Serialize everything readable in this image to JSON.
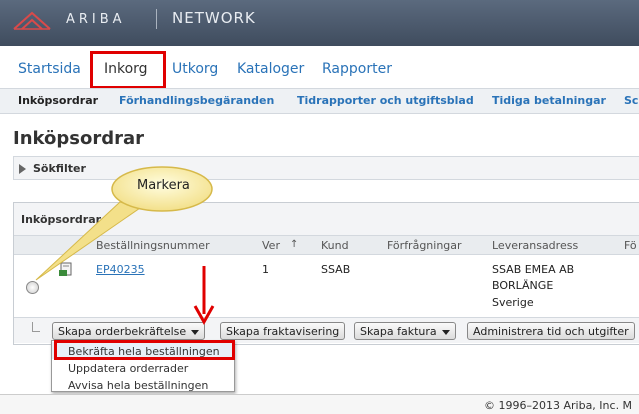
{
  "header": {
    "brand": "ARIBA",
    "product": "NETWORK",
    "logo_icon": "ariba-logo-icon"
  },
  "tabs": [
    {
      "label": "Startsida"
    },
    {
      "label": "Inkorg",
      "active": true
    },
    {
      "label": "Utkorg"
    },
    {
      "label": "Kataloger"
    },
    {
      "label": "Rapporter"
    }
  ],
  "subnav": [
    {
      "label": "Inköpsordrar",
      "active": true
    },
    {
      "label": "Förhandlingsbegäranden"
    },
    {
      "label": "Tidrapporter och utgiftsblad"
    },
    {
      "label": "Tidiga betalningar"
    },
    {
      "label": "Sc"
    }
  ],
  "page_title": "Inköpsordrar",
  "filter": {
    "label": "Sökfilter"
  },
  "panel": {
    "title": "Inköpsordrar",
    "columns": [
      "Beställningsnummer",
      "Ver",
      "Kund",
      "Förfrågningar",
      "Leveransadress",
      "Fö"
    ],
    "sort_icon": "sort-ascending-icon",
    "rows": [
      {
        "order_number": "EP40235",
        "ver": "1",
        "customer": "SSAB",
        "requests": "",
        "address_line1": "SSAB EMEA AB",
        "address_line2": "BORLÄNGE",
        "address_line3": "Sverige"
      }
    ]
  },
  "actions": {
    "create_confirmation": "Skapa orderbekräftelse",
    "create_shipping": "Skapa fraktavisering",
    "create_invoice": "Skapa faktura",
    "manage_time": "Administrera tid och utgifter"
  },
  "dropdown": {
    "items": [
      {
        "label": "Bekräfta hela beställningen",
        "highlighted": true
      },
      {
        "label": "Uppdatera orderrader"
      },
      {
        "label": "Avvisa hela beställningen"
      }
    ]
  },
  "callout": {
    "label": "Markera"
  },
  "footer": {
    "copyright": "© 1996–2013 Ariba, Inc. M"
  },
  "colors": {
    "accent": "#2a73b8",
    "highlight": "#e00000",
    "header": "#4a586b"
  }
}
